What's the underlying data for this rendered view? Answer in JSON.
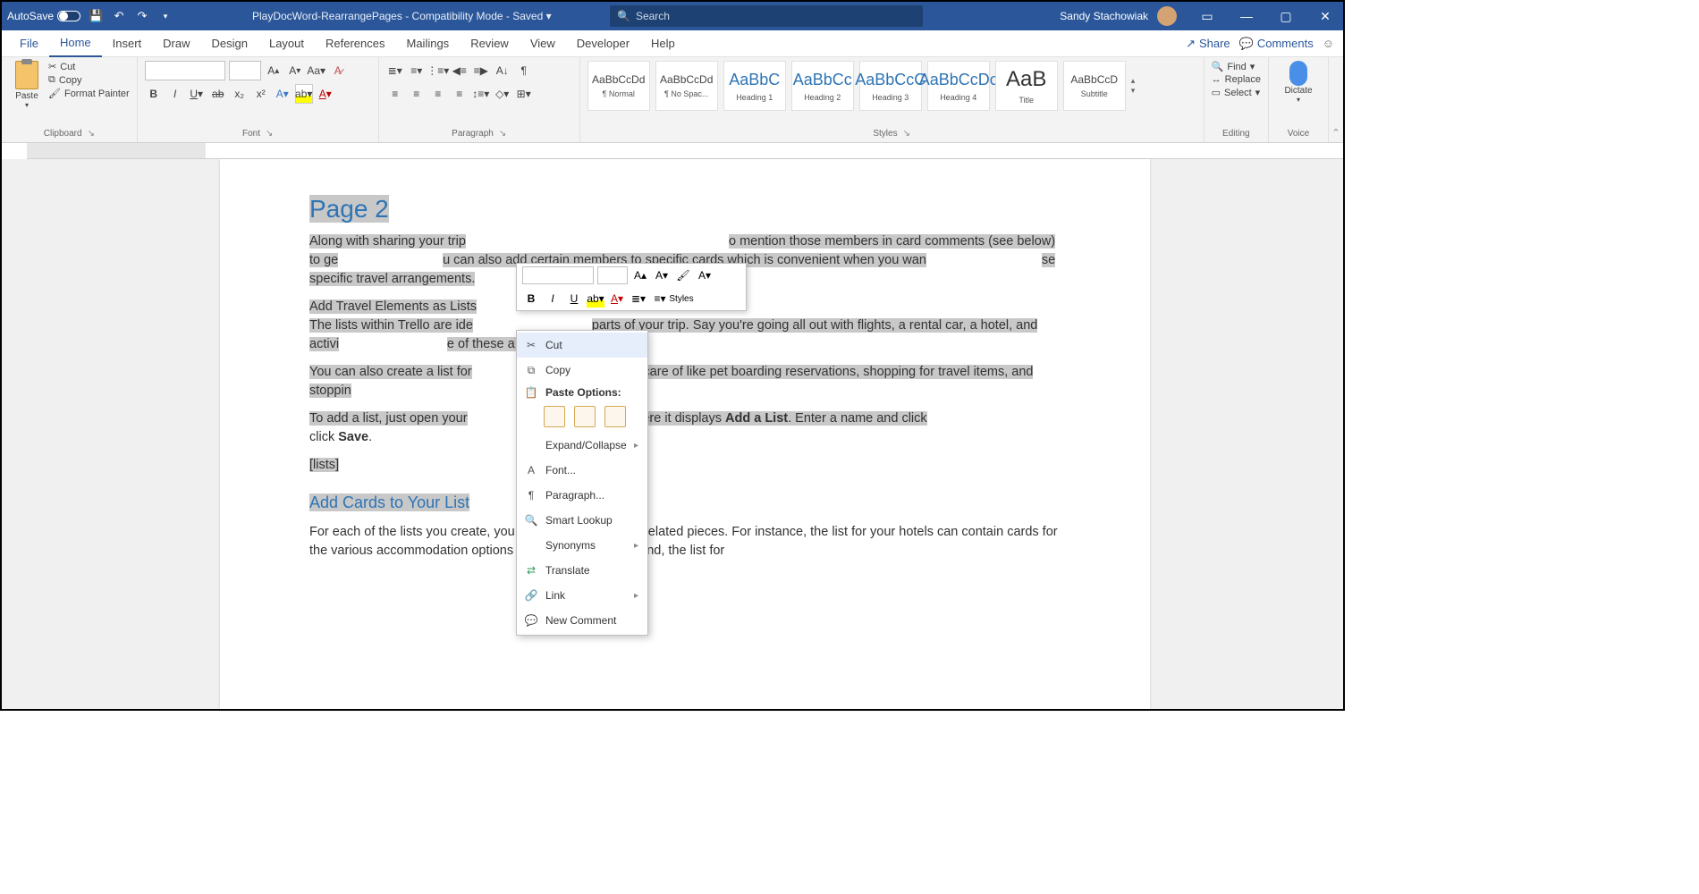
{
  "titlebar": {
    "autosave": "AutoSave",
    "doc_title": "PlayDocWord-RearrangePages  -  Compatibility Mode  -  Saved  ▾",
    "search_placeholder": "Search",
    "user": "Sandy Stachowiak"
  },
  "tabs": {
    "file": "File",
    "home": "Home",
    "insert": "Insert",
    "draw": "Draw",
    "design": "Design",
    "layout": "Layout",
    "references": "References",
    "mailings": "Mailings",
    "review": "Review",
    "view": "View",
    "developer": "Developer",
    "help": "Help",
    "share": "Share",
    "comments": "Comments"
  },
  "clipboard": {
    "paste": "Paste",
    "cut": "Cut",
    "copy": "Copy",
    "format_painter": "Format Painter",
    "label": "Clipboard"
  },
  "font": {
    "label": "Font"
  },
  "paragraph": {
    "label": "Paragraph"
  },
  "styles": {
    "label": "Styles",
    "items": [
      {
        "preview": "AaBbCcDd",
        "name": "¶ Normal",
        "cls": ""
      },
      {
        "preview": "AaBbCcDd",
        "name": "¶ No Spac...",
        "cls": ""
      },
      {
        "preview": "AaBbC",
        "name": "Heading 1",
        "cls": "heading"
      },
      {
        "preview": "AaBbCc",
        "name": "Heading 2",
        "cls": "heading"
      },
      {
        "preview": "AaBbCcC",
        "name": "Heading 3",
        "cls": "heading"
      },
      {
        "preview": "AaBbCcDc",
        "name": "Heading 4",
        "cls": "heading"
      },
      {
        "preview": "AaB",
        "name": "Title",
        "cls": "title"
      },
      {
        "preview": "AaBbCcD",
        "name": "Subtitle",
        "cls": ""
      }
    ]
  },
  "editing": {
    "find": "Find",
    "replace": "Replace",
    "select": "Select",
    "label": "Editing"
  },
  "voice": {
    "dictate": "Dictate",
    "label": "Voice"
  },
  "context": {
    "cut": "Cut",
    "copy": "Copy",
    "paste_options": "Paste Options:",
    "expand": "Expand/Collapse",
    "font": "Font...",
    "paragraph": "Paragraph...",
    "smart_lookup": "Smart Lookup",
    "synonyms": "Synonyms",
    "translate": "Translate",
    "link": "Link",
    "new_comment": "New Comment",
    "styles_lbl": "Styles"
  },
  "doc": {
    "h1": "Page 2",
    "p1a": "Along with sharing your trip",
    "p1b": "o mention those members in card comments (see below) to ge",
    "p1c": "u can also add certain members to specific cards which is convenient when you wan",
    "p1d": "se specific travel arrangements.",
    "p2a": "Add Travel Elements as Lists",
    "p2b": "The lists within Trello are ide",
    "p2c": "parts of your trip. Say you're going all out with flights, a rental car, a hotel, and activi",
    "p2d": "e of these a list.",
    "p3a": "You can also create a list for",
    "p3b": "s to take care of like pet boarding reservations, shopping for travel items, and stoppin",
    "p4a": "To add a list, just open your",
    "p4b": "d click where it displays ",
    "p4c": "Add a List",
    "p4d": ". Enter a name and click ",
    "p4e": "Save",
    "p4f": ".",
    "p5": "[lists]",
    "h2": "Add Cards to Your List",
    "p6": "For each of the lists you create, you can add cards for the related pieces. For instance, the list for your hotels can contain cards for the various accommodation options you are researching. And, the list for"
  }
}
